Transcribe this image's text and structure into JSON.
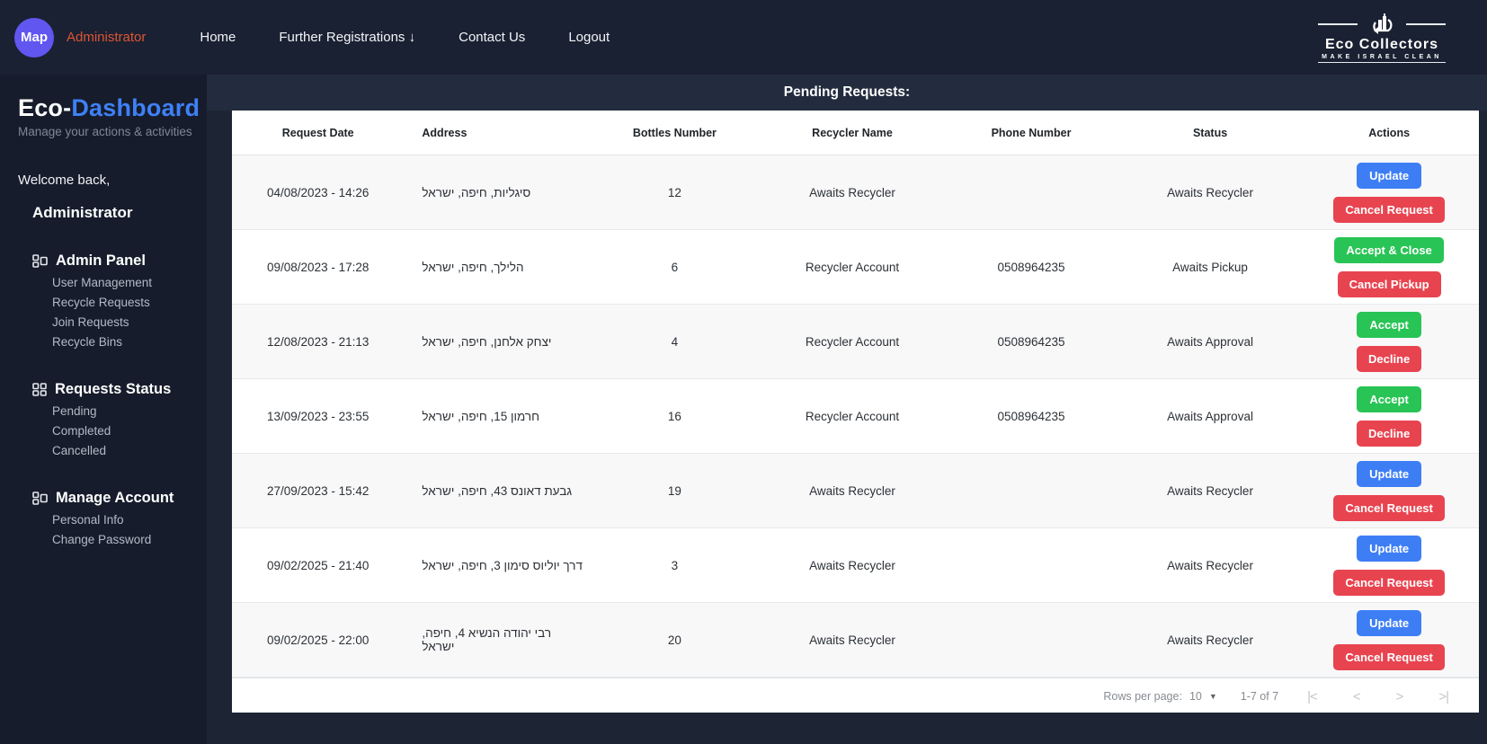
{
  "colors": {
    "navbar_bg": "#1a2132",
    "sidebar_bg": "#161c2b",
    "main_bg": "#1d2535",
    "header_bar_bg": "#222c3e",
    "accent_blue": "#3f80f6",
    "btn_blue": "#3d7ef5",
    "btn_red": "#e84450",
    "btn_green": "#28c455",
    "brand_circle": "#6156f0",
    "nav_user_orange": "#dd5533"
  },
  "navbar": {
    "brand": "Map",
    "user": "Administrator",
    "links": [
      {
        "label": "Home"
      },
      {
        "label": "Further Registrations ↓"
      },
      {
        "label": "Contact Us"
      },
      {
        "label": "Logout"
      }
    ],
    "logo": {
      "title": "Eco Collectors",
      "tagline": "MAKE ISRAEL CLEAN"
    }
  },
  "sidebar": {
    "title_prefix": "Eco-",
    "title_accent": "Dashboard",
    "subtitle": "Manage your actions & activities",
    "welcome": "Welcome back,",
    "username": "Administrator",
    "sections": [
      {
        "label": "Admin Panel",
        "items": [
          {
            "label": "User Management"
          },
          {
            "label": "Recycle Requests"
          },
          {
            "label": "Join Requests"
          },
          {
            "label": "Recycle Bins"
          }
        ]
      },
      {
        "label": "Requests Status",
        "items": [
          {
            "label": "Pending"
          },
          {
            "label": "Completed"
          },
          {
            "label": "Cancelled"
          }
        ]
      },
      {
        "label": "Manage Account",
        "items": [
          {
            "label": "Personal Info"
          },
          {
            "label": "Change Password"
          }
        ]
      }
    ]
  },
  "main": {
    "title": "Pending Requests:",
    "table": {
      "columns": [
        "Request Date",
        "Address",
        "Bottles Number",
        "Recycler Name",
        "Phone Number",
        "Status",
        "Actions"
      ],
      "rows": [
        {
          "date": "04/08/2023 - 14:26",
          "address": "סיגליות, חיפה, ישראל",
          "bottles": "12",
          "recycler": "Awaits Recycler",
          "phone": "",
          "status": "Awaits Recycler",
          "actions": [
            {
              "label": "Update",
              "color": "blue"
            },
            {
              "label": "Cancel Request",
              "color": "red"
            }
          ]
        },
        {
          "date": "09/08/2023 - 17:28",
          "address": "הלילך, חיפה, ישראל",
          "bottles": "6",
          "recycler": "Recycler Account",
          "phone": "0508964235",
          "status": "Awaits Pickup",
          "actions": [
            {
              "label": "Accept & Close",
              "color": "green"
            },
            {
              "label": "Cancel Pickup",
              "color": "red"
            }
          ]
        },
        {
          "date": "12/08/2023 - 21:13",
          "address": "יצחק אלחנן, חיפה, ישראל",
          "bottles": "4",
          "recycler": "Recycler Account",
          "phone": "0508964235",
          "status": "Awaits Approval",
          "actions": [
            {
              "label": "Accept",
              "color": "green"
            },
            {
              "label": "Decline",
              "color": "red"
            }
          ]
        },
        {
          "date": "13/09/2023 - 23:55",
          "address": "חרמון 15, חיפה, ישראל",
          "bottles": "16",
          "recycler": "Recycler Account",
          "phone": "0508964235",
          "status": "Awaits Approval",
          "actions": [
            {
              "label": "Accept",
              "color": "green"
            },
            {
              "label": "Decline",
              "color": "red"
            }
          ]
        },
        {
          "date": "27/09/2023 - 15:42",
          "address": "גבעת דאונס 43, חיפה, ישראל",
          "bottles": "19",
          "recycler": "Awaits Recycler",
          "phone": "",
          "status": "Awaits Recycler",
          "actions": [
            {
              "label": "Update",
              "color": "blue"
            },
            {
              "label": "Cancel Request",
              "color": "red"
            }
          ]
        },
        {
          "date": "09/02/2025 - 21:40",
          "address": "דרך יוליוס סימון 3, חיפה, ישראל",
          "bottles": "3",
          "recycler": "Awaits Recycler",
          "phone": "",
          "status": "Awaits Recycler",
          "actions": [
            {
              "label": "Update",
              "color": "blue"
            },
            {
              "label": "Cancel Request",
              "color": "red"
            }
          ]
        },
        {
          "date": "09/02/2025 - 22:00",
          "address": "רבי יהודה הנשיא 4, חיפה, ישראל",
          "bottles": "20",
          "recycler": "Awaits Recycler",
          "phone": "",
          "status": "Awaits Recycler",
          "actions": [
            {
              "label": "Update",
              "color": "blue"
            },
            {
              "label": "Cancel Request",
              "color": "red"
            }
          ]
        }
      ],
      "footer": {
        "rows_per_page_label": "Rows per page:",
        "rows_per_page_value": "10",
        "range": "1-7 of 7",
        "first_icon": "|<",
        "prev_icon": "<",
        "next_icon": ">",
        "last_icon": ">|"
      }
    }
  }
}
